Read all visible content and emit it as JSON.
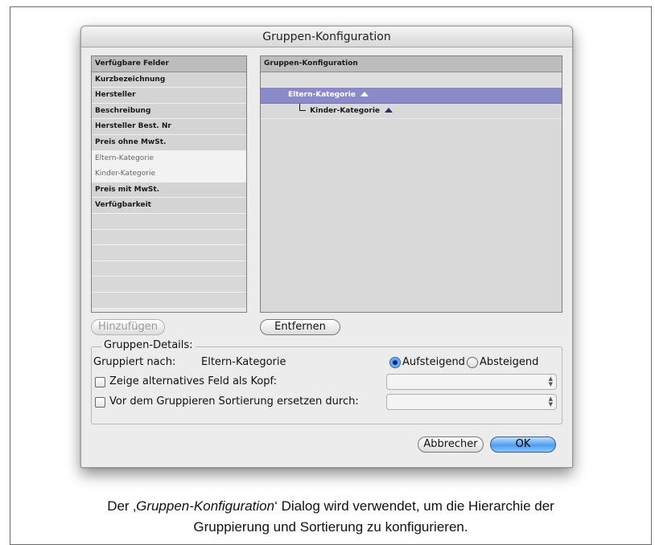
{
  "dialog": {
    "title": "Gruppen-Konfiguration",
    "left_list": {
      "header": "Verfügbare Felder",
      "items": [
        {
          "label": "Kurzbezeichnung",
          "state": "available"
        },
        {
          "label": "Hersteller",
          "state": "available"
        },
        {
          "label": "Beschreibung",
          "state": "available"
        },
        {
          "label": "Hersteller Best. Nr",
          "state": "available"
        },
        {
          "label": "Preis ohne MwSt.",
          "state": "available"
        },
        {
          "label": "Eltern-Kategorie",
          "state": "used"
        },
        {
          "label": "Kinder-Kategorie",
          "state": "used"
        },
        {
          "label": "Preis mit MwSt.",
          "state": "available"
        },
        {
          "label": "Verfügbarkeit",
          "state": "available"
        }
      ]
    },
    "right_tree": {
      "header": "Gruppen-Konfiguration",
      "items": [
        {
          "label": "Eltern-Kategorie",
          "level": 0,
          "selected": true,
          "sort_icon": "ascending-triangle-icon"
        },
        {
          "label": "Kinder-Kategorie",
          "level": 1,
          "selected": false,
          "sort_icon": "ascending-triangle-icon"
        }
      ]
    },
    "buttons": {
      "add": "Hinzufügen",
      "remove": "Entfernen",
      "cancel": "Abbrecher",
      "ok": "OK"
    },
    "details": {
      "legend": "Gruppen-Details:",
      "grouped_by_label": "Gruppiert nach:",
      "grouped_by_value": "Eltern-Kategorie",
      "ascending_label": "Aufsteigend",
      "descending_label": "Absteigend",
      "sort_order_selected": "ascending",
      "alt_header_label": "Zeige alternatives Feld als Kopf:",
      "alt_header_checked": false,
      "replace_sort_label": "Vor dem Gruppieren Sortierung ersetzen durch:",
      "replace_sort_checked": false
    }
  },
  "caption": {
    "prefix": "Der ‚",
    "emphasis": "Gruppen-Konfiguration",
    "suffix": "‘ Dialog wird verwendet, um die Hierarchie der",
    "line2": "Gruppierung und Sortierung zu konfigurieren."
  },
  "colors": {
    "selected_row": "#8b8ac8",
    "primary_button": "#4f9df0",
    "dialog_bg": "#ececec"
  }
}
